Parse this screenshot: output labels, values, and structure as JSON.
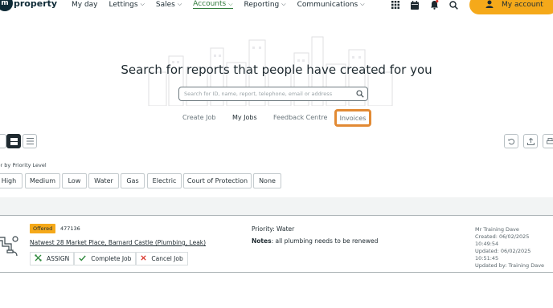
{
  "app": {
    "logo_badge": "m",
    "logo_text": "property"
  },
  "nav": {
    "items": [
      {
        "label": "My day",
        "has_menu": false
      },
      {
        "label": "Lettings",
        "has_menu": true
      },
      {
        "label": "Sales",
        "has_menu": true
      },
      {
        "label": "Accounts",
        "has_menu": true
      },
      {
        "label": "Reporting",
        "has_menu": true
      },
      {
        "label": "Communications",
        "has_menu": true
      }
    ],
    "active_item": "Accounts",
    "account_label": "My account",
    "chevron": "⌵"
  },
  "icons": {
    "apps": "grid-icon",
    "calendar": "calendar-icon",
    "notifications": "bell-icon",
    "search": "search-icon"
  },
  "hero": {
    "title": "Search for reports that people have created for you",
    "search_placeholder": "Search for ID, name, report, telephone, email or address"
  },
  "tabs": [
    {
      "label": "Create Job"
    },
    {
      "label": "My Jobs"
    },
    {
      "label": "Feedback Centre"
    },
    {
      "label": "Invoices"
    }
  ],
  "selected_tab": "My Jobs",
  "highlighted_tab": "Invoices",
  "filter": {
    "label": "ter by Priority Level",
    "pills": [
      "High",
      "Medium",
      "Low",
      "Water",
      "Gas",
      "Electric",
      "Court of Protection",
      "None"
    ]
  },
  "job": {
    "status": "Offered",
    "id": "477136",
    "title": "Natwest 28 Market Place, Barnard Castle (Plumbing, Leak)",
    "priority": "Priority: Water",
    "notes_label": "Notes",
    "notes_text": ": all plumbing needs to be renewed",
    "actions": [
      {
        "label": "ASSIGN",
        "icon": "assign-icon"
      },
      {
        "label": "Complete Job",
        "icon": "check-icon"
      },
      {
        "label": "Cancel Job",
        "icon": "cross-icon"
      }
    ],
    "meta": [
      "Mr Training Dave",
      "Created: 06/02/2025",
      "10:49:54",
      "Updated: 06/02/2025",
      "10:51:45",
      "Updated by: Training Dave"
    ]
  },
  "colors": {
    "accent": "#f5a91a",
    "highlight": "#e28a34",
    "active_nav": "#2f7a3a",
    "check": "#2f8a3e",
    "cross": "#d9342b"
  }
}
